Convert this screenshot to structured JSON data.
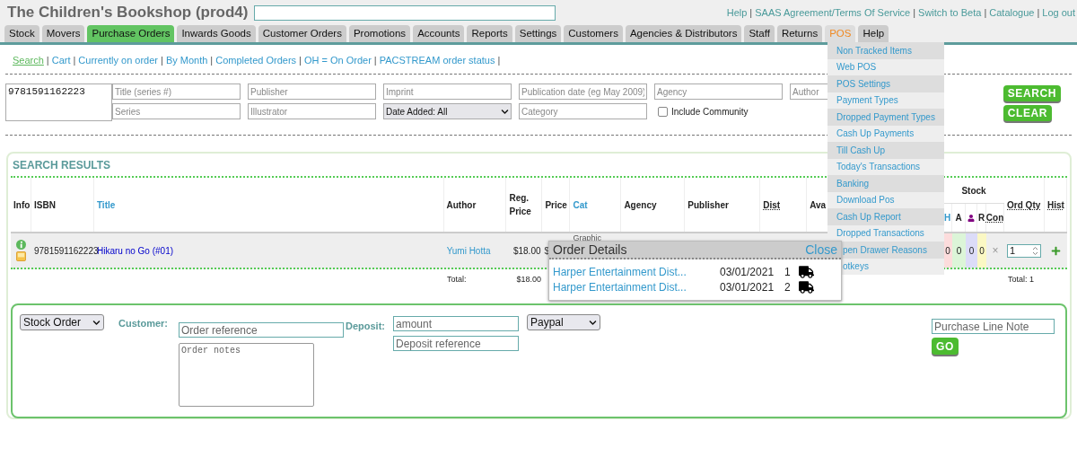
{
  "app_title": "The Children's Bookshop (prod4)",
  "top_links": [
    "Help",
    "SAAS Agreement/Terms Of Service",
    "Switch to Beta",
    "Catalogue",
    "Log out"
  ],
  "separator": "|",
  "tabs": [
    {
      "label": "Stock",
      "selected": false,
      "highlighted": false
    },
    {
      "label": "Movers",
      "selected": false,
      "highlighted": false
    },
    {
      "label": "Purchase Orders",
      "selected": true,
      "highlighted": false
    },
    {
      "label": "Inwards Goods",
      "selected": false,
      "highlighted": false
    },
    {
      "label": "Customer Orders",
      "selected": false,
      "highlighted": false
    },
    {
      "label": "Promotions",
      "selected": false,
      "highlighted": false
    },
    {
      "label": "Accounts",
      "selected": false,
      "highlighted": false
    },
    {
      "label": "Reports",
      "selected": false,
      "highlighted": false
    },
    {
      "label": "Settings",
      "selected": false,
      "highlighted": false
    },
    {
      "label": "Customers",
      "selected": false,
      "highlighted": false
    },
    {
      "label": "Agencies & Distributors",
      "selected": false,
      "highlighted": false
    },
    {
      "label": "Staff",
      "selected": false,
      "highlighted": false
    },
    {
      "label": "Returns",
      "selected": false,
      "highlighted": false
    },
    {
      "label": "POS",
      "selected": false,
      "highlighted": true
    },
    {
      "label": "Help",
      "selected": false,
      "highlighted": false
    }
  ],
  "sub_links": [
    {
      "label": "Search",
      "selected": true
    },
    {
      "label": "Cart",
      "selected": false
    },
    {
      "label": "Currently on order",
      "selected": false
    },
    {
      "label": "By Month",
      "selected": false
    },
    {
      "label": "Completed Orders",
      "selected": false
    },
    {
      "label": "OH = On Order",
      "selected": false
    },
    {
      "label": "PACSTREAM order status",
      "selected": false
    }
  ],
  "search_form": {
    "isbn_value": "9781591162223",
    "row_1": [
      {
        "kind": "input",
        "placeholder": "Title (series #)"
      },
      {
        "kind": "input",
        "placeholder": "Publisher"
      },
      {
        "kind": "input",
        "placeholder": "Imprint"
      },
      {
        "kind": "input",
        "placeholder": "Publication date (eg May 2009)"
      },
      {
        "kind": "input",
        "placeholder": "Agency"
      },
      {
        "kind": "input",
        "placeholder": "Author"
      }
    ],
    "row_2": [
      {
        "kind": "input",
        "placeholder": "Series"
      },
      {
        "kind": "input",
        "placeholder": "Illustrator"
      },
      {
        "kind": "select",
        "value": "Date Added: All"
      },
      {
        "kind": "input",
        "placeholder": "Category"
      },
      {
        "kind": "checkbox",
        "label": "Include Community",
        "checked": false
      }
    ],
    "buttons": [
      "SEARCH",
      "CLEAR"
    ]
  },
  "results": {
    "title": "SEARCH RESULTS",
    "columns": [
      "Info",
      "ISBN",
      "Title",
      "Author",
      "Reg. Price",
      "Price",
      "Cat",
      "Agency",
      "Publisher",
      "Dist",
      "Ava"
    ],
    "stock": {
      "label": "Stock",
      "columns": [
        {
          "kind": "text",
          "label": "H"
        },
        {
          "kind": "text",
          "label": "A"
        },
        {
          "kind": "icon"
        },
        {
          "kind": "text",
          "label": "R"
        },
        {
          "kind": "text",
          "label": "Con"
        }
      ]
    },
    "end_columns": [
      "Ord Qty",
      "Hist"
    ],
    "rows": [
      {
        "isbn": "9781591162223",
        "title": "Hikaru no Go (#01)",
        "author": "Yumi Hotta",
        "reg_price": "$18.00",
        "price": "$",
        "cat": "Graphic",
        "stock": [
          "0",
          "0",
          "0",
          "0"
        ],
        "con": "×",
        "ord_qty": "1"
      }
    ],
    "totals": {
      "label": "Total:",
      "reg_price": "$18.00",
      "qty": "Total: 1"
    }
  },
  "pos_menu": [
    "Non Tracked Items",
    "Web POS",
    "POS Settings",
    "Payment Types",
    "Dropped Payment Types",
    "Cash Up Payments",
    "Till Cash Up",
    "Today's Transactions",
    "Banking",
    "Download Pos",
    "Cash Up Report",
    "Dropped Transactions",
    "pen Drawer Reasons",
    "otkeys"
  ],
  "order_details": {
    "title": "Order Details",
    "close": "Close",
    "rows": [
      {
        "distributor": "Harper Entertainment Dist...",
        "date": "03/01/2021",
        "qty": "1"
      },
      {
        "distributor": "Harper Entertainment Dist...",
        "date": "03/01/2021",
        "qty": "2"
      }
    ]
  },
  "order_form": {
    "type": "Stock Order",
    "customer_label": "Customer:",
    "reference_placeholder": "Order reference",
    "notes_placeholder": "Order notes",
    "deposit_label": "Deposit:",
    "amount_placeholder": "amount",
    "deposit_reference_placeholder": "Deposit reference",
    "payment": "Paypal",
    "line_note_placeholder": "Purchase Line Note",
    "go": "GO"
  }
}
